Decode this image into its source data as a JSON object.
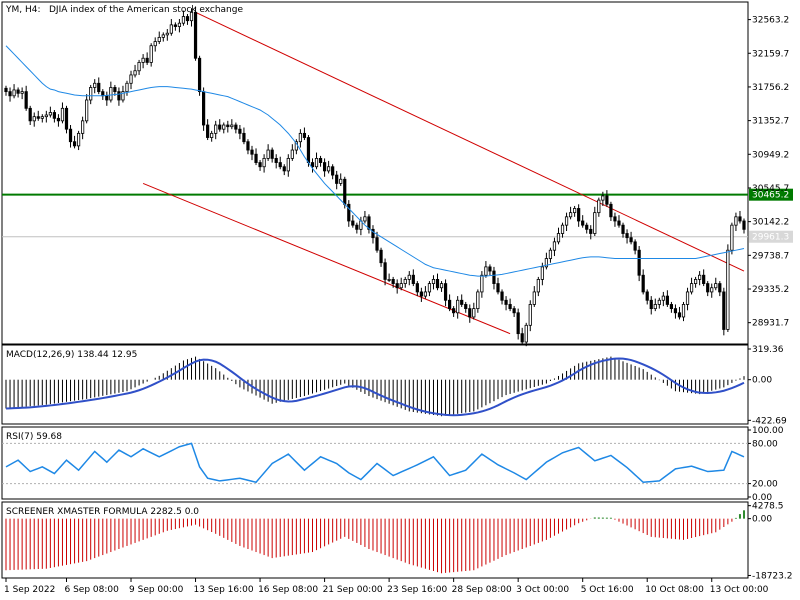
{
  "header": {
    "symbol_tf": "YM, H4:",
    "description": "DJIA index of the American stock exchange"
  },
  "colors": {
    "background": "#ffffff",
    "frame": "#000000",
    "candle": "#000000",
    "ma": "#1e88e5",
    "channel": "#d00000",
    "level": "#007a00",
    "macd_signal": "#3050c8",
    "rsi": "#1e88e5",
    "screener_pos": "#2e8b2e",
    "screener_neg": "#cc0000"
  },
  "price_panel": {
    "ylim": [
      28700,
      32750
    ],
    "ticks": [
      "32563.2",
      "32159.7",
      "31756.2",
      "31352.7",
      "30949.2",
      "30545.7",
      "30142.2",
      "29738.7",
      "29335.2",
      "28931.7"
    ],
    "tick_values": [
      32563.2,
      32159.7,
      31756.2,
      31352.7,
      30949.2,
      30545.7,
      30142.2,
      29738.7,
      29335.2,
      28931.7
    ],
    "level_label": "30465.2",
    "level_value": 30465.2,
    "current_label": "29961.3",
    "current_value": 29961.3
  },
  "macd_panel": {
    "title": "MACD(12,26,9) 138.44 12.95",
    "ylim": [
      -440,
      340
    ],
    "ticks": [
      "319.36",
      "0.00",
      "-422.69"
    ],
    "tick_values": [
      319.36,
      0,
      -422.69
    ]
  },
  "rsi_panel": {
    "title": "RSI(7) 59.68",
    "ylim": [
      0,
      100
    ],
    "ticks": [
      "100.00",
      "80.00",
      "20.00",
      "0.00"
    ],
    "tick_values": [
      100,
      80,
      20,
      0
    ]
  },
  "screener_panel": {
    "title": "SCREENER XMASTER FORMULA 2282.5 0.0",
    "ylim": [
      -18900,
      4500
    ],
    "ticks": [
      "4278.5",
      "0.00",
      "-18723.2"
    ],
    "tick_values": [
      4278.5,
      0,
      -18723.2
    ]
  },
  "x_axis": {
    "labels": [
      "1 Sep 2022",
      "6 Sep 08:00",
      "9 Sep 00:00",
      "13 Sep 16:00",
      "16 Sep 08:00",
      "21 Sep 00:00",
      "23 Sep 16:00",
      "28 Sep 08:00",
      "3 Oct 00:00",
      "5 Oct 16:00",
      "10 Oct 08:00",
      "13 Oct 00:00"
    ],
    "label_bars": [
      0,
      15,
      31,
      47,
      63,
      79,
      95,
      111,
      127,
      143,
      159,
      175
    ]
  },
  "chart_data": {
    "type": "line",
    "x": "H4 bars 0-183, from 1 Sep 2022 to 14 Oct 2022",
    "close": [
      31700,
      31650,
      31720,
      31680,
      31700,
      31500,
      31350,
      31400,
      31380,
      31400,
      31420,
      31450,
      31380,
      31350,
      31500,
      31250,
      31100,
      31050,
      31200,
      31350,
      31600,
      31750,
      31800,
      31700,
      31650,
      31600,
      31750,
      31700,
      31600,
      31700,
      31800,
      31900,
      31950,
      32050,
      32100,
      32050,
      32250,
      32300,
      32350,
      32380,
      32400,
      32500,
      32480,
      32520,
      32600,
      32550,
      32650,
      32100,
      31700,
      31300,
      31150,
      31200,
      31300,
      31250,
      31300,
      31280,
      31300,
      31250,
      31200,
      31100,
      31000,
      30950,
      30850,
      30800,
      30900,
      31000,
      30900,
      30850,
      30800,
      30750,
      30900,
      31000,
      31100,
      31200,
      31150,
      30850,
      30800,
      30900,
      30850,
      30750,
      30800,
      30700,
      30600,
      30650,
      30350,
      30150,
      30100,
      30050,
      30150,
      30200,
      30050,
      29950,
      29800,
      29650,
      29450,
      29450,
      29400,
      29350,
      29400,
      29450,
      29500,
      29400,
      29300,
      29250,
      29300,
      29400,
      29450,
      29350,
      29400,
      29200,
      29100,
      29050,
      29200,
      29150,
      29100,
      29000,
      29100,
      29300,
      29500,
      29600,
      29550,
      29400,
      29300,
      29200,
      29150,
      29100,
      29050,
      28800,
      28700,
      28900,
      29150,
      29300,
      29450,
      29600,
      29700,
      29800,
      29900,
      30000,
      30100,
      30200,
      30250,
      30300,
      30150,
      30100,
      30050,
      30000,
      30250,
      30400,
      30450,
      30350,
      30200,
      30150,
      30100,
      30000,
      29950,
      29900,
      29800,
      29500,
      29300,
      29200,
      29100,
      29150,
      29200,
      29250,
      29150,
      29100,
      29050,
      29000,
      29150,
      29300,
      29400,
      29450,
      29500,
      29400,
      29300,
      29350,
      29400,
      29300,
      28850,
      29800,
      30100,
      30200,
      30150,
      30050
    ],
    "ma": [
      32250,
      32200,
      32150,
      32100,
      32050,
      32000,
      31950,
      31900,
      31850,
      31800,
      31760,
      31730,
      31720,
      31700,
      31690,
      31680,
      31670,
      31660,
      31655,
      31650,
      31650,
      31650,
      31650,
      31650,
      31650,
      31655,
      31660,
      31665,
      31670,
      31680,
      31690,
      31700,
      31710,
      31720,
      31730,
      31740,
      31750,
      31755,
      31760,
      31760,
      31760,
      31755,
      31750,
      31745,
      31740,
      31735,
      31730,
      31720,
      31710,
      31700,
      31690,
      31680,
      31670,
      31660,
      31650,
      31640,
      31620,
      31600,
      31580,
      31560,
      31540,
      31520,
      31500,
      31480,
      31450,
      31420,
      31380,
      31340,
      31300,
      31250,
      31200,
      31140,
      31080,
      31000,
      30920,
      30850,
      30780,
      30720,
      30660,
      30600,
      30550,
      30500,
      30450,
      30400,
      30350,
      30300,
      30250,
      30200,
      30150,
      30100,
      30060,
      30020,
      29990,
      29960,
      29930,
      29900,
      29870,
      29840,
      29810,
      29780,
      29750,
      29720,
      29690,
      29660,
      29630,
      29610,
      29590,
      29580,
      29570,
      29560,
      29550,
      29540,
      29530,
      29520,
      29510,
      29500,
      29495,
      29490,
      29490,
      29490,
      29495,
      29500,
      29505,
      29510,
      29520,
      29530,
      29540,
      29550,
      29560,
      29570,
      29580,
      29590,
      29600,
      29610,
      29620,
      29630,
      29640,
      29650,
      29660,
      29670,
      29680,
      29690,
      29700,
      29710,
      29715,
      29720,
      29720,
      29720,
      29715,
      29710,
      29705,
      29700,
      29700,
      29700,
      29700,
      29700,
      29700,
      29700,
      29700,
      29700,
      29700,
      29700,
      29700,
      29700,
      29700,
      29700,
      29700,
      29700,
      29700,
      29700,
      29700,
      29700,
      29710,
      29720,
      29730,
      29740,
      29750,
      29760,
      29770,
      29780,
      29790,
      29800,
      29810,
      29820
    ],
    "channel_upper": {
      "start": {
        "bar": 47,
        "price": 32650
      },
      "end": {
        "bar": 183,
        "price": 29550
      }
    },
    "channel_lower": {
      "start": {
        "bar": 34,
        "price": 30600
      },
      "end": {
        "bar": 125,
        "price": 28800
      }
    },
    "level": 30465.2,
    "macd_keypoints": [
      [
        0,
        -300
      ],
      [
        10,
        -260
      ],
      [
        20,
        -200
      ],
      [
        30,
        -120
      ],
      [
        38,
        40
      ],
      [
        44,
        200
      ],
      [
        47,
        240
      ],
      [
        52,
        120
      ],
      [
        58,
        -80
      ],
      [
        66,
        -250
      ],
      [
        74,
        -170
      ],
      [
        84,
        -40
      ],
      [
        90,
        -170
      ],
      [
        100,
        -330
      ],
      [
        108,
        -380
      ],
      [
        116,
        -330
      ],
      [
        124,
        -160
      ],
      [
        134,
        -40
      ],
      [
        142,
        170
      ],
      [
        150,
        240
      ],
      [
        158,
        110
      ],
      [
        166,
        -120
      ],
      [
        172,
        -150
      ],
      [
        178,
        -80
      ],
      [
        184,
        60
      ]
    ],
    "rsi_keypoints": [
      [
        0,
        45
      ],
      [
        3,
        55
      ],
      [
        6,
        38
      ],
      [
        9,
        45
      ],
      [
        12,
        35
      ],
      [
        15,
        55
      ],
      [
        18,
        40
      ],
      [
        22,
        68
      ],
      [
        25,
        52
      ],
      [
        28,
        70
      ],
      [
        31,
        60
      ],
      [
        34,
        72
      ],
      [
        38,
        60
      ],
      [
        43,
        75
      ],
      [
        46,
        80
      ],
      [
        48,
        45
      ],
      [
        50,
        28
      ],
      [
        53,
        24
      ],
      [
        58,
        28
      ],
      [
        62,
        22
      ],
      [
        66,
        50
      ],
      [
        70,
        64
      ],
      [
        74,
        40
      ],
      [
        78,
        60
      ],
      [
        82,
        50
      ],
      [
        85,
        36
      ],
      [
        88,
        26
      ],
      [
        92,
        50
      ],
      [
        96,
        32
      ],
      [
        102,
        48
      ],
      [
        106,
        60
      ],
      [
        110,
        32
      ],
      [
        114,
        40
      ],
      [
        118,
        64
      ],
      [
        122,
        48
      ],
      [
        126,
        36
      ],
      [
        129,
        26
      ],
      [
        134,
        52
      ],
      [
        138,
        66
      ],
      [
        142,
        74
      ],
      [
        146,
        54
      ],
      [
        150,
        62
      ],
      [
        154,
        44
      ],
      [
        158,
        22
      ],
      [
        162,
        24
      ],
      [
        166,
        42
      ],
      [
        170,
        46
      ],
      [
        174,
        38
      ],
      [
        178,
        40
      ],
      [
        180,
        68
      ],
      [
        183,
        60
      ]
    ],
    "screener_keypoints": [
      [
        0,
        -17000
      ],
      [
        10,
        -16500
      ],
      [
        20,
        -14000
      ],
      [
        30,
        -9000
      ],
      [
        40,
        -4000
      ],
      [
        47,
        -2000
      ],
      [
        52,
        -5000
      ],
      [
        58,
        -9000
      ],
      [
        66,
        -13000
      ],
      [
        76,
        -11000
      ],
      [
        84,
        -6000
      ],
      [
        90,
        -10000
      ],
      [
        100,
        -15000
      ],
      [
        108,
        -18000
      ],
      [
        116,
        -17000
      ],
      [
        124,
        -12000
      ],
      [
        134,
        -7000
      ],
      [
        142,
        -1500
      ],
      [
        146,
        400
      ],
      [
        150,
        300
      ],
      [
        152,
        -1000
      ],
      [
        160,
        -6000
      ],
      [
        168,
        -7000
      ],
      [
        176,
        -4500
      ],
      [
        180,
        -1000
      ],
      [
        184,
        4000
      ]
    ]
  }
}
